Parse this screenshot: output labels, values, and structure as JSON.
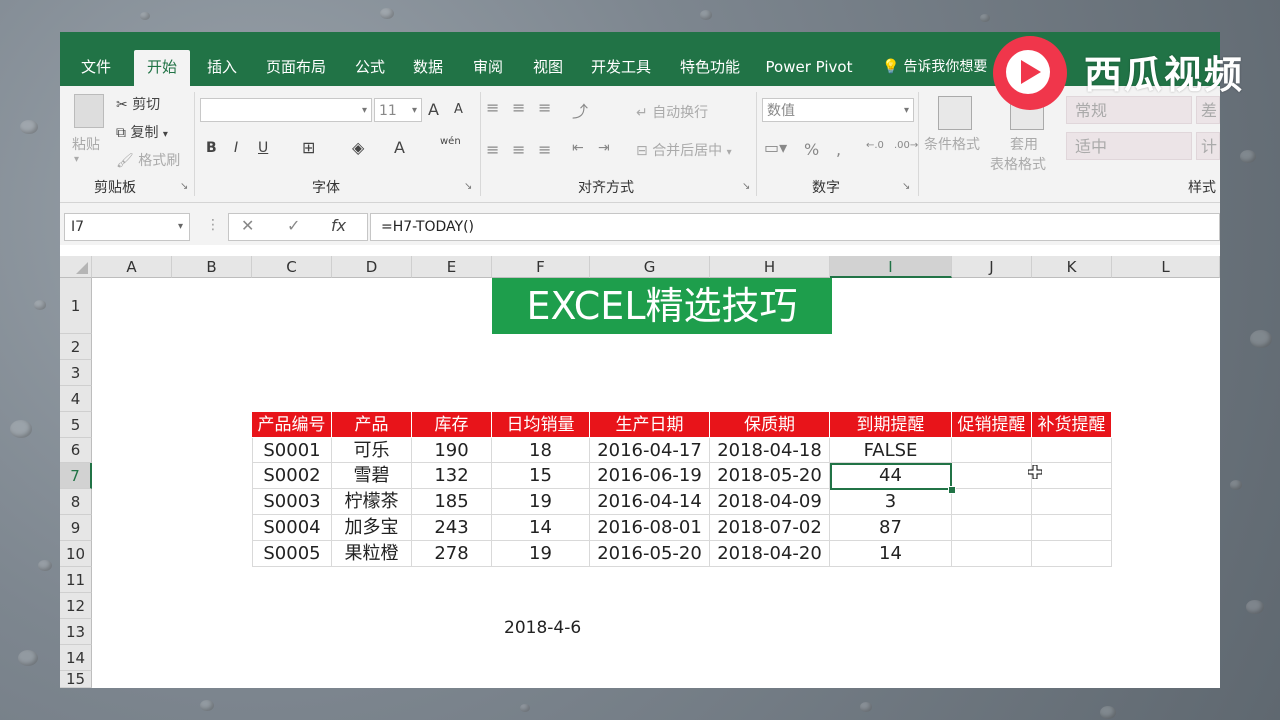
{
  "ribbon_tabs": [
    "文件",
    "开始",
    "插入",
    "页面布局",
    "公式",
    "数据",
    "审阅",
    "视图",
    "开发工具",
    "特色功能",
    "Power Pivot"
  ],
  "active_tab": "开始",
  "tell_me": "告诉我你想要",
  "watermark": {
    "text": "西瓜视频",
    "logo_icon": "play-icon",
    "color": "#f0364b"
  },
  "clipboard": {
    "paste": "粘贴",
    "cut": "剪切",
    "copy": "复制",
    "format_painter": "格式刷",
    "label": "剪贴板"
  },
  "font": {
    "name": "",
    "size": "11",
    "label": "字体",
    "grow": "A",
    "shrink": "A",
    "bold": "B",
    "italic": "I",
    "underline": "U"
  },
  "alignment": {
    "wrap": "自动换行",
    "merge": "合并后居中",
    "label": "对齐方式"
  },
  "number": {
    "format": "数值",
    "percent": "%",
    "comma": ",",
    "label": "数字"
  },
  "styles": {
    "conditional": "条件格式",
    "table_format_1": "套用",
    "table_format_2": "表格格式",
    "normal": "常规",
    "neutral": "适中",
    "label": "样式",
    "cut_right_1": "差",
    "cut_right_2": "计"
  },
  "name_box": "I7",
  "formula": "=H7-TODAY()",
  "fx": "fx",
  "columns": [
    "A",
    "B",
    "C",
    "D",
    "E",
    "F",
    "G",
    "H",
    "I",
    "J",
    "K",
    "L"
  ],
  "selected_column": "I",
  "rows": [
    "1",
    "2",
    "3",
    "4",
    "5",
    "6",
    "7",
    "8",
    "9",
    "10",
    "11",
    "12",
    "13",
    "14",
    "15"
  ],
  "selected_row": "7",
  "banner": "EXCEL精选技巧",
  "table": {
    "headers": [
      "产品编号",
      "产品",
      "库存",
      "日均销量",
      "生产日期",
      "保质期",
      "到期提醒",
      "促销提醒",
      "补货提醒"
    ],
    "rows": [
      [
        "S0001",
        "可乐",
        "190",
        "18",
        "2016-04-17",
        "2018-04-18",
        "FALSE",
        "",
        ""
      ],
      [
        "S0002",
        "雪碧",
        "132",
        "15",
        "2016-06-19",
        "2018-05-20",
        "44",
        "",
        ""
      ],
      [
        "S0003",
        "柠檬茶",
        "185",
        "19",
        "2016-04-14",
        "2018-04-09",
        "3",
        "",
        ""
      ],
      [
        "S0004",
        "加多宝",
        "243",
        "14",
        "2016-08-01",
        "2018-07-02",
        "87",
        "",
        ""
      ],
      [
        "S0005",
        "果粒橙",
        "278",
        "19",
        "2016-05-20",
        "2018-04-20",
        "14",
        "",
        ""
      ]
    ],
    "header_color": "#e8141a"
  },
  "today_value": "2018-4-6",
  "theme": {
    "excel_green": "#217346",
    "banner_green": "#1e9e4c"
  }
}
